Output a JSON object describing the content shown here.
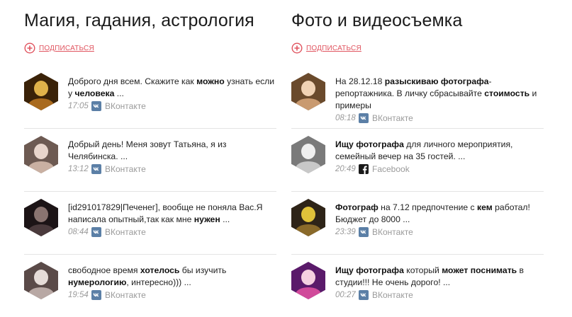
{
  "columns": [
    {
      "title": "Магия, гадания, астрология",
      "subscribe_label": "ПОДПИСАТЬСЯ",
      "posts": [
        {
          "segments": [
            {
              "t": "Доброго дня всем. Скажите как "
            },
            {
              "t": "можно",
              "b": true
            },
            {
              "t": " узнать если у "
            },
            {
              "t": "человека",
              "b": true
            },
            {
              "t": " ..."
            }
          ],
          "time": "17:05",
          "network": "ВКонтакте",
          "network_icon": "vk-icon",
          "avatar_colors": [
            "#3a2208",
            "#a96a1e",
            "#e0b24a"
          ]
        },
        {
          "segments": [
            {
              "t": "Добрый день! Меня зовут Татьяна, я из Челябинска. ..."
            }
          ],
          "time": "13:12",
          "network": "ВКонтакте",
          "network_icon": "vk-icon",
          "avatar_colors": [
            "#6d5a52",
            "#c9b0a2",
            "#e8d5cb"
          ]
        },
        {
          "segments": [
            {
              "t": "[id291017829|Печенег], вообще не поняла Вас.Я написала опытный,так как мне "
            },
            {
              "t": "нужен",
              "b": true
            },
            {
              "t": " ..."
            }
          ],
          "time": "08:44",
          "network": "ВКонтакте",
          "network_icon": "vk-icon",
          "avatar_colors": [
            "#1c1416",
            "#4a3a3c",
            "#8a7470"
          ]
        },
        {
          "segments": [
            {
              "t": "свободное время "
            },
            {
              "t": "хотелось",
              "b": true
            },
            {
              "t": " бы изучить "
            },
            {
              "t": "нумерологию",
              "b": true
            },
            {
              "t": ", интересно))) ..."
            }
          ],
          "time": "19:54",
          "network": "ВКонтакте",
          "network_icon": "vk-icon",
          "avatar_colors": [
            "#5a4a48",
            "#b8a8a4",
            "#e6dcd8"
          ]
        }
      ]
    },
    {
      "title": "Фото и видеосъемка",
      "subscribe_label": "ПОДПИСАТЬСЯ",
      "posts": [
        {
          "segments": [
            {
              "t": "На 28.12.18 "
            },
            {
              "t": "разыскиваю фотографа",
              "b": true
            },
            {
              "t": "-репортажника. В личку сбрасывайте "
            },
            {
              "t": "стоимость",
              "b": true
            },
            {
              "t": " и примеры"
            }
          ],
          "time": "08:18",
          "network": "ВКонтакте",
          "network_icon": "vk-icon",
          "avatar_colors": [
            "#6a4a2c",
            "#c99a70",
            "#f0d2b4"
          ]
        },
        {
          "segments": [
            {
              "t": "Ищу фотографа",
              "b": true
            },
            {
              "t": " для личного мероприятия, семейный вечер на 35 гостей. ..."
            }
          ],
          "time": "20:49",
          "network": "Facebook",
          "network_icon": "facebook-icon",
          "avatar_colors": [
            "#7a7a7a",
            "#c8c8c8",
            "#efefef"
          ]
        },
        {
          "segments": [
            {
              "t": "Фотограф",
              "b": true
            },
            {
              "t": " на 7.12 предпочтение с "
            },
            {
              "t": "кем",
              "b": true
            },
            {
              "t": " работал! Бюджет до 8000 ..."
            }
          ],
          "time": "23:39",
          "network": "ВКонтакте",
          "network_icon": "vk-icon",
          "avatar_colors": [
            "#2e2418",
            "#8a6a2a",
            "#e0c23a"
          ]
        },
        {
          "segments": [
            {
              "t": "Ищу фотографа",
              "b": true
            },
            {
              "t": " который "
            },
            {
              "t": "может поснимать",
              "b": true
            },
            {
              "t": " в студии!!! Не очень дорого! ..."
            }
          ],
          "time": "00:27",
          "network": "ВКонтакте",
          "network_icon": "vk-icon",
          "avatar_colors": [
            "#5a1a6a",
            "#d04a9a",
            "#f5d0e0"
          ]
        }
      ]
    }
  ],
  "colors": {
    "accent": "#e0535e",
    "muted": "#9a9a9a",
    "vk_icon": "#5b7fa6",
    "facebook_icon": "#1a1a1a",
    "divider": "#e4e4e4"
  }
}
